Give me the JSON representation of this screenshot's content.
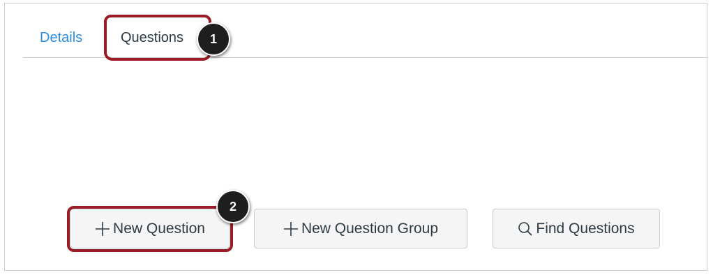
{
  "tabs": {
    "details_label": "Details",
    "questions_label": "Questions"
  },
  "callouts": {
    "first": "1",
    "second": "2"
  },
  "buttons": {
    "new_question": "New Question",
    "new_question_group": "New Question Group",
    "find_questions": "Find Questions"
  },
  "icons": {
    "new_question": "plus-icon",
    "new_question_group": "plus-icon",
    "find_questions": "search-icon"
  },
  "colors": {
    "link": "#2d8ede",
    "text": "#2d3b45",
    "highlight": "#9b1b24",
    "callout": "#1e1e1e"
  }
}
